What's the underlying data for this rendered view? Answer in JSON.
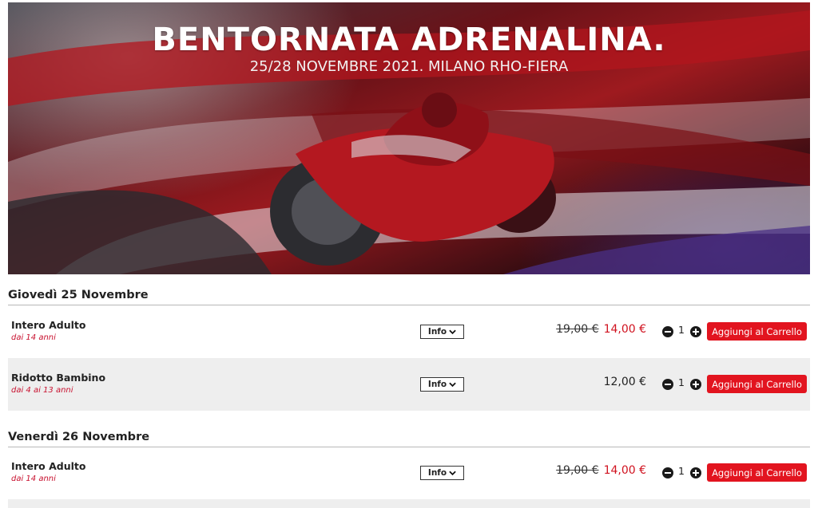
{
  "hero": {
    "title": "BENTORNATA ADRENALINA.",
    "subtitle": "25/28 NOVEMBRE 2021. MILANO RHO-FIERA"
  },
  "days": [
    {
      "heading": "Giovedì 25 Novembre",
      "tickets": [
        {
          "name": "Intero Adulto",
          "age": "dai 14 anni",
          "info_label": "Info",
          "old_price": "19,00 €",
          "price": "14,00 €",
          "qty": "1",
          "add_label": "Aggiungi al Carrello"
        },
        {
          "name": "Ridotto Bambino",
          "age": "dai 4 ai 13 anni",
          "info_label": "Info",
          "price": "12,00 €",
          "qty": "1",
          "add_label": "Aggiungi al Carrello"
        }
      ]
    },
    {
      "heading": "Venerdì 26 Novembre",
      "tickets": [
        {
          "name": "Intero Adulto",
          "age": "dai 14 anni",
          "info_label": "Info",
          "old_price": "19,00 €",
          "price": "14,00 €",
          "qty": "1",
          "add_label": "Aggiungi al Carrello"
        }
      ]
    }
  ],
  "icons": {
    "info_chevron": "chevron-down-icon",
    "minus": "minus-circle-icon",
    "plus": "plus-circle-icon"
  },
  "colors": {
    "accent_red": "#e2141f",
    "price_red": "#d0121f",
    "age_red": "#c8102e",
    "alt_row": "#eeeeee"
  }
}
